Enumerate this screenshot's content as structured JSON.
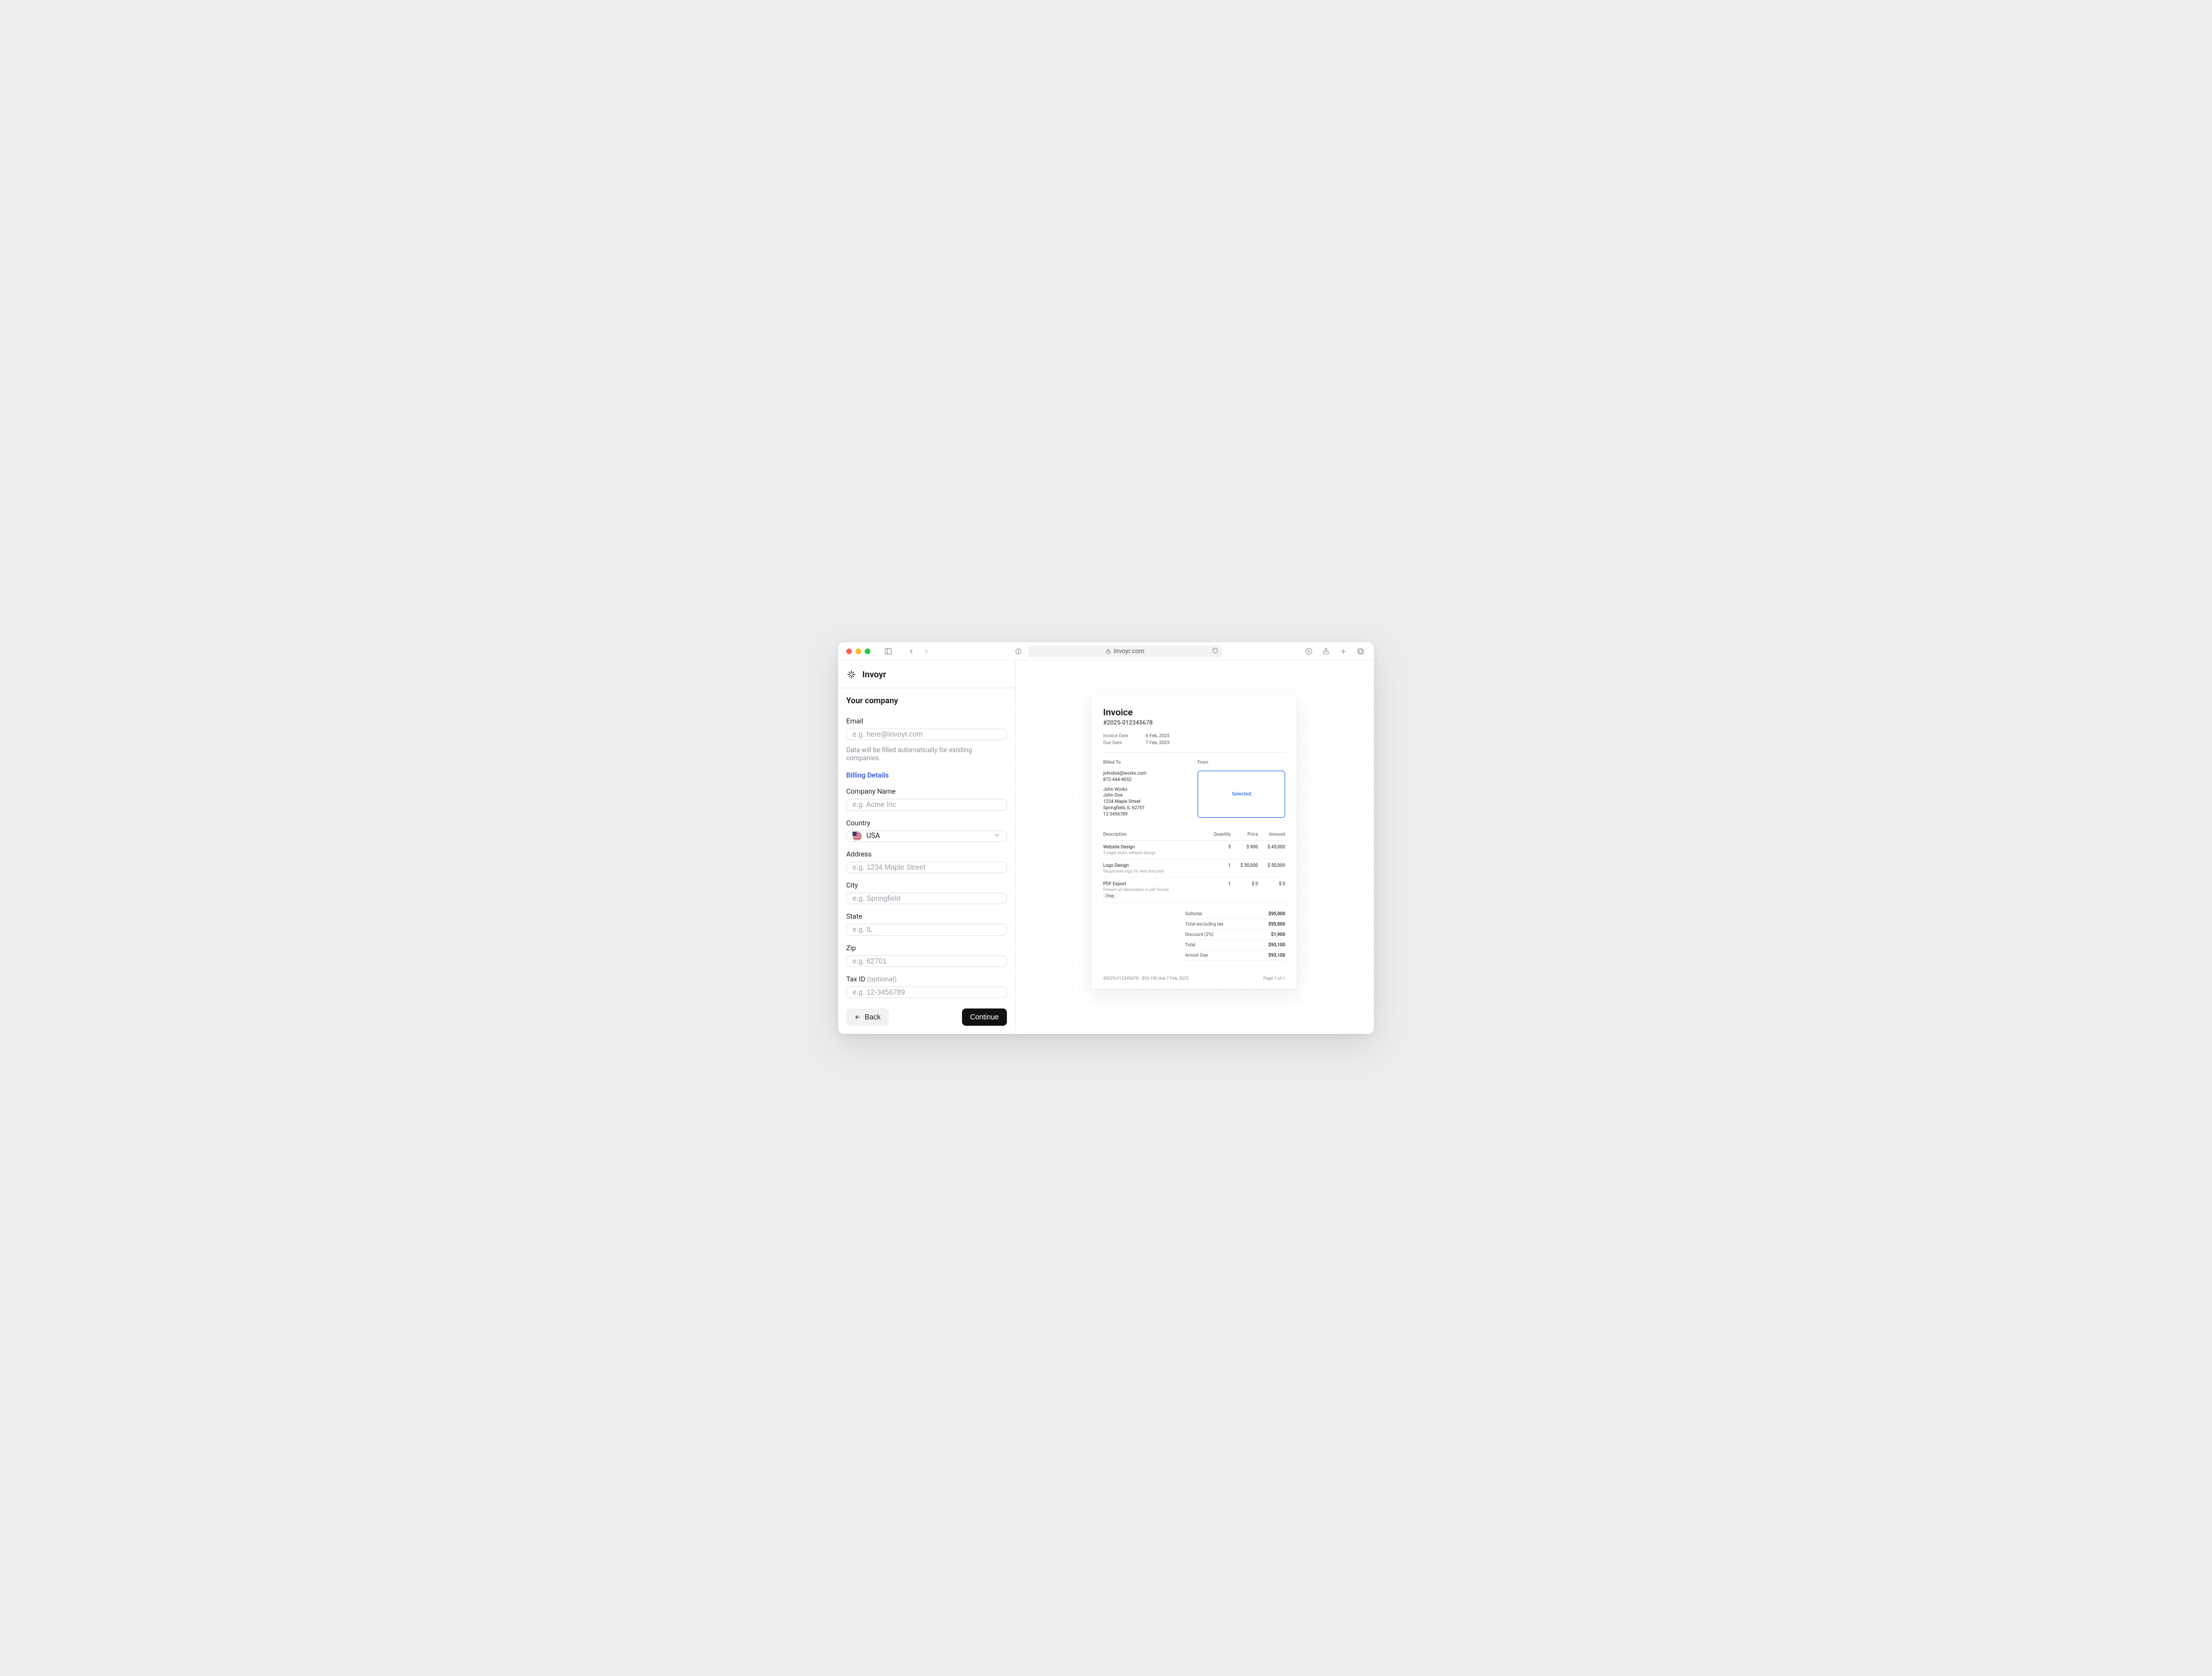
{
  "chrome": {
    "url_host": "invoyr.com"
  },
  "brand": {
    "name": "Invoyr"
  },
  "form": {
    "title": "Your company",
    "email_label": "Email",
    "email_placeholder": "e.g. here@invoyr.com",
    "email_helper": "Data will be filled automatically for existing companies.",
    "billing_header": "Billing Details",
    "company_label": "Company Name",
    "company_placeholder": "e.g. Acme Inc",
    "country_label": "Country",
    "country_value": "USA",
    "address_label": "Address",
    "address_placeholder": "e.g. 1234 Maple Street",
    "city_label": "City",
    "city_placeholder": "e.g. Springfield",
    "state_label": "State",
    "state_placeholder": "e.g. IL",
    "zip_label": "Zip",
    "zip_placeholder": "e.g. 62701",
    "taxid_label": "Tax ID",
    "taxid_optional": "(optional)",
    "taxid_placeholder": "e.g. 12-3456789",
    "back": "Back",
    "continue": "Continue"
  },
  "invoice": {
    "title": "Invoice",
    "number": "#2025-012345678",
    "invoice_date_label": "Invoice Date",
    "invoice_date": "6 Feb, 2025",
    "due_date_label": "Due Date",
    "due_date": "7 Feb, 2025",
    "billed_to_label": "Billed To",
    "from_label": "From",
    "selected_text": "Selected",
    "billed_to": {
      "email": "johndoe@works.com",
      "phone": "872-444-4652",
      "company": "John Works",
      "name": "John Doe",
      "street": "1234 Maple Street",
      "city_line": "Springfield, IL 62701",
      "tax": "12-3456789"
    },
    "columns": {
      "desc": "Description",
      "qty": "Quantity",
      "price": "Price",
      "amount": "Amount"
    },
    "items": [
      {
        "desc": "Website Design",
        "sub": "5 pager static website design",
        "qty": "5",
        "price": "$ 900",
        "amount": "$ 45,000"
      },
      {
        "desc": "Logo Design",
        "sub": "Responsive logo for web and print",
        "qty": "1",
        "price": "$ 50,000",
        "amount": "$ 50,000"
      },
      {
        "desc": "PDF Export",
        "sub": "Present all deliverables in pdf format",
        "qty": "1",
        "price": "$ 0",
        "amount": "$ 0",
        "free": "Free"
      }
    ],
    "totals": {
      "subtotal_k": "Subtotal",
      "subtotal_v": "$95,000",
      "excl_k": "Total excluding tax",
      "excl_v": "$95,000",
      "discount_k": "Discount (2%)",
      "discount_v": "$1,900",
      "total_k": "Total",
      "total_v": "$93,100",
      "due_k": "Amout Due",
      "due_v": "$93,100"
    },
    "footer_left": "#2025-012345678 · $93,100 due 7 Feb, 2025",
    "footer_right": "Page 1 of 1"
  }
}
